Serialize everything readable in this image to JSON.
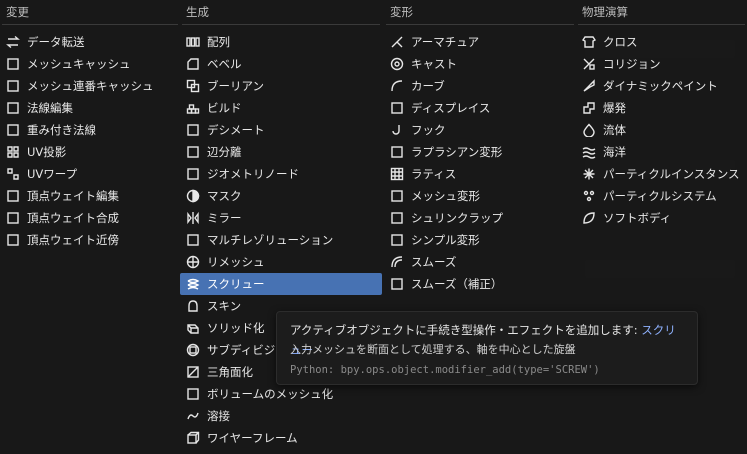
{
  "columns": [
    {
      "header": "変更",
      "items": [
        {
          "label": "データ転送",
          "icon": "data-transfer-icon"
        },
        {
          "label": "メッシュキャッシュ",
          "icon": "mesh-cache-icon"
        },
        {
          "label": "メッシュ連番キャッシュ",
          "icon": "mesh-sequence-cache-icon"
        },
        {
          "label": "法線編集",
          "icon": "normal-edit-icon"
        },
        {
          "label": "重み付き法線",
          "icon": "weighted-normal-icon"
        },
        {
          "label": "UV投影",
          "icon": "uv-project-icon"
        },
        {
          "label": "UVワープ",
          "icon": "uv-warp-icon"
        },
        {
          "label": "頂点ウェイト編集",
          "icon": "vertex-weight-edit-icon"
        },
        {
          "label": "頂点ウェイト合成",
          "icon": "vertex-weight-mix-icon"
        },
        {
          "label": "頂点ウェイト近傍",
          "icon": "vertex-weight-proximity-icon"
        }
      ]
    },
    {
      "header": "生成",
      "items": [
        {
          "label": "配列",
          "icon": "array-icon"
        },
        {
          "label": "ベベル",
          "icon": "bevel-icon"
        },
        {
          "label": "ブーリアン",
          "icon": "boolean-icon"
        },
        {
          "label": "ビルド",
          "icon": "build-icon"
        },
        {
          "label": "デシメート",
          "icon": "decimate-icon"
        },
        {
          "label": "辺分離",
          "icon": "edge-split-icon"
        },
        {
          "label": "ジオメトリノード",
          "icon": "geometry-nodes-icon"
        },
        {
          "label": "マスク",
          "icon": "mask-icon"
        },
        {
          "label": "ミラー",
          "icon": "mirror-icon"
        },
        {
          "label": "マルチレゾリューション",
          "icon": "multires-icon"
        },
        {
          "label": "リメッシュ",
          "icon": "remesh-icon"
        },
        {
          "label": "スクリュー",
          "icon": "screw-icon",
          "active": true
        },
        {
          "label": "スキン",
          "icon": "skin-icon"
        },
        {
          "label": "ソリッド化",
          "icon": "solidify-icon"
        },
        {
          "label": "サブディビジ",
          "icon": "subdivision-icon"
        },
        {
          "label": "三角面化",
          "icon": "triangulate-icon"
        },
        {
          "label": "ボリュームのメッシュ化",
          "icon": "volume-to-mesh-icon"
        },
        {
          "label": "溶接",
          "icon": "weld-icon"
        },
        {
          "label": "ワイヤーフレーム",
          "icon": "wireframe-icon"
        }
      ]
    },
    {
      "header": "変形",
      "items": [
        {
          "label": "アーマチュア",
          "icon": "armature-icon"
        },
        {
          "label": "キャスト",
          "icon": "cast-icon"
        },
        {
          "label": "カーブ",
          "icon": "curve-icon"
        },
        {
          "label": "ディスプレイス",
          "icon": "displace-icon"
        },
        {
          "label": "フック",
          "icon": "hook-icon"
        },
        {
          "label": "ラプラシアン変形",
          "icon": "laplacian-deform-icon"
        },
        {
          "label": "ラティス",
          "icon": "lattice-icon"
        },
        {
          "label": "メッシュ変形",
          "icon": "mesh-deform-icon"
        },
        {
          "label": "シュリンクラップ",
          "icon": "shrinkwrap-icon"
        },
        {
          "label": "シンプル変形",
          "icon": "simple-deform-icon"
        },
        {
          "label": "スムーズ",
          "icon": "smooth-icon"
        },
        {
          "label": "スムーズ（補正）",
          "icon": "smooth-corrective-icon"
        }
      ]
    },
    {
      "header": "物理演算",
      "items": [
        {
          "label": "クロス",
          "icon": "cloth-icon"
        },
        {
          "label": "コリジョン",
          "icon": "collision-icon"
        },
        {
          "label": "ダイナミックペイント",
          "icon": "dynamic-paint-icon"
        },
        {
          "label": "爆発",
          "icon": "explode-icon"
        },
        {
          "label": "流体",
          "icon": "fluid-icon"
        },
        {
          "label": "海洋",
          "icon": "ocean-icon"
        },
        {
          "label": "パーティクルインスタンス",
          "icon": "particle-instance-icon"
        },
        {
          "label": "パーティクルシステム",
          "icon": "particle-system-icon"
        },
        {
          "label": "ソフトボディ",
          "icon": "soft-body-icon"
        }
      ]
    }
  ],
  "tooltip": {
    "description": "アクティブオブジェクトに手続き型操作・エフェクトを追加します: ",
    "item_name": "スクリュー",
    "detail": "入力メッシュを断面として処理する、軸を中心とした旋盤",
    "python": "Python: bpy.ops.object.modifier_add(type='SCREW')"
  },
  "colors": {
    "highlight": "#4772b3",
    "background": "#181818",
    "tooltip_accent": "#8fb2ff"
  }
}
